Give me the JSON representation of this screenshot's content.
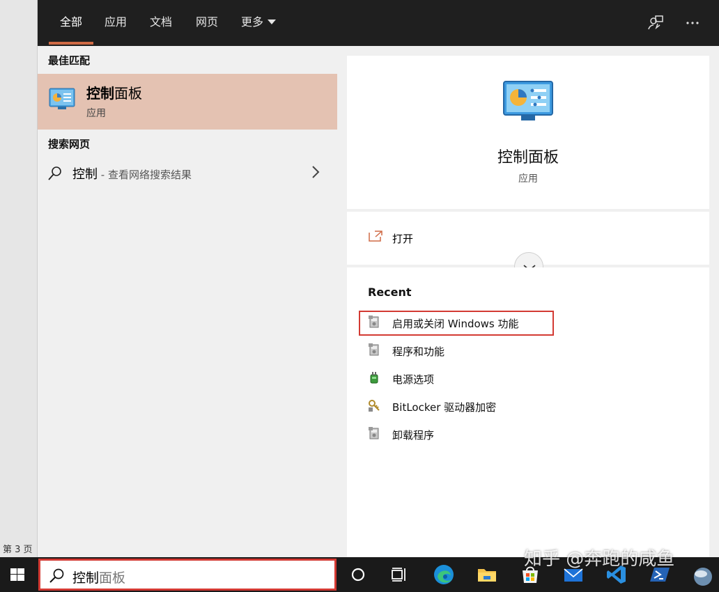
{
  "page": {
    "number_label": "第 3 页"
  },
  "tabs": [
    {
      "label": "全部",
      "active": true
    },
    {
      "label": "应用",
      "active": false
    },
    {
      "label": "文档",
      "active": false
    },
    {
      "label": "网页",
      "active": false
    },
    {
      "label": "更多",
      "active": false
    }
  ],
  "top_icons": {
    "feedback": "feedback-icon",
    "more": "more-options-icon"
  },
  "left": {
    "best_match_heading": "最佳匹配",
    "best_match": {
      "title_bold": "控制",
      "title_rest": "面板",
      "subtitle": "应用",
      "icon": "control-panel-icon"
    },
    "web_heading": "搜索网页",
    "web_result": {
      "term": "控制",
      "hint": " - 查看网络搜索结果"
    }
  },
  "preview": {
    "title": "控制面板",
    "subtitle": "应用",
    "open_label": "打开",
    "recent_heading": "Recent",
    "recent_items": [
      {
        "label": "启用或关闭 Windows 功能",
        "icon": "programs-icon"
      },
      {
        "label": "程序和功能",
        "icon": "programs-icon"
      },
      {
        "label": "电源选项",
        "icon": "power-options-icon"
      },
      {
        "label": "BitLocker 驱动器加密",
        "icon": "bitlocker-key-icon"
      },
      {
        "label": "卸载程序",
        "icon": "programs-icon"
      }
    ]
  },
  "taskbar": {
    "query_typed": "控制",
    "query_suggest": "面板",
    "apps": [
      "cortana-icon",
      "task-view-icon",
      "edge-icon",
      "file-explorer-icon",
      "store-icon",
      "mail-icon",
      "vscode-icon",
      "powershell-icon",
      "weather-icon"
    ]
  },
  "watermark": "知乎 @奔跑的咸鱼",
  "colors": {
    "accent": "#cf6a45",
    "highlight_red": "#d33a33",
    "selection": "#e4c2b2",
    "topbar": "#1f1f1f",
    "taskbar": "#1a1a1a"
  }
}
